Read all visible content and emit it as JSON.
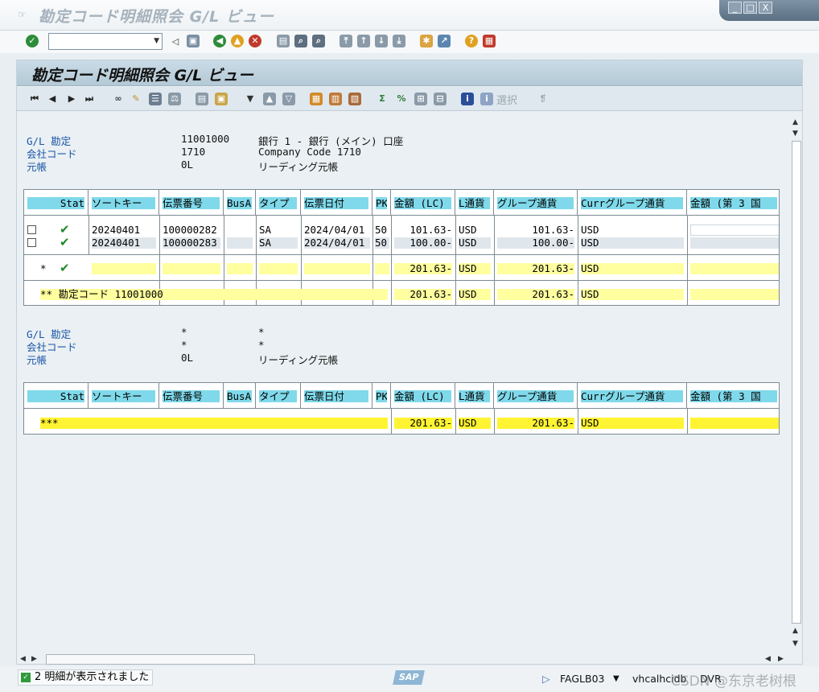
{
  "window": {
    "title": "勘定コード明細照会 G/L ビュー",
    "controls": [
      "_",
      "□",
      "X"
    ]
  },
  "toolbar": {
    "command_value": ""
  },
  "screen": {
    "title": "勘定コード明細照会 G/L ビュー",
    "select_label": "選択"
  },
  "section1": {
    "labels": {
      "account": "G/L 勘定",
      "company": "会社コード",
      "ledger": "元帳"
    },
    "values": {
      "account": "11001000",
      "account_desc": "銀行 1 - 銀行 (メイン) 口座",
      "company": "1710",
      "company_desc": "Company Code 1710",
      "ledger": "0L",
      "ledger_desc": "リーディング元帳"
    }
  },
  "section2": {
    "labels": {
      "account": "G/L 勘定",
      "company": "会社コード",
      "ledger": "元帳"
    },
    "values": {
      "account": "*",
      "account_desc": "*",
      "company": "*",
      "company_desc": "*",
      "ledger": "0L",
      "ledger_desc": "リーディング元帳"
    }
  },
  "columns": [
    "Stat",
    "ソートキー",
    "伝票番号",
    "BusA",
    "タイプ",
    "伝票日付",
    "PK",
    "金額 (LC)",
    "L通貨",
    "グループ通貨",
    "Currグループ通貨",
    "金額 (第 3 国"
  ],
  "grid1": {
    "rows": [
      {
        "sort_key": "20240401",
        "doc_no": "100000282",
        "busa": "",
        "type": "SA",
        "doc_date": "2024/04/01",
        "pk": "50",
        "amount_lc": "101.63-",
        "l_curr": "USD",
        "group_amount": "101.63-",
        "group_curr": "USD",
        "amount3": ""
      },
      {
        "sort_key": "20240401",
        "doc_no": "100000283",
        "busa": "",
        "type": "SA",
        "doc_date": "2024/04/01",
        "pk": "50",
        "amount_lc": "100.00-",
        "l_curr": "USD",
        "group_amount": "100.00-",
        "group_curr": "USD",
        "amount3": ""
      }
    ],
    "subtotal": {
      "marker": "*",
      "amount_lc": "201.63-",
      "l_curr": "USD",
      "group_amount": "201.63-",
      "group_curr": "USD"
    },
    "total": {
      "label": "** 勘定コード 11001000",
      "amount_lc": "201.63-",
      "l_curr": "USD",
      "group_amount": "201.63-",
      "group_curr": "USD"
    }
  },
  "grid2": {
    "grand_total": {
      "label": "***",
      "amount_lc": "201.63-",
      "l_curr": "USD",
      "group_amount": "201.63-",
      "group_curr": "USD"
    }
  },
  "status": {
    "message": "2 明細が表示されました",
    "sap_logo": "SAP",
    "transaction": "FAGLB03",
    "server": "vhcalhcidb",
    "system": "DVR",
    "watermark": "CSDN @东京老树根"
  },
  "colors": {
    "header_cell": "#7fd9ea",
    "subtotal": "#ffffa0",
    "grand_total": "#fff433",
    "label_blue": "#1b55a8"
  }
}
